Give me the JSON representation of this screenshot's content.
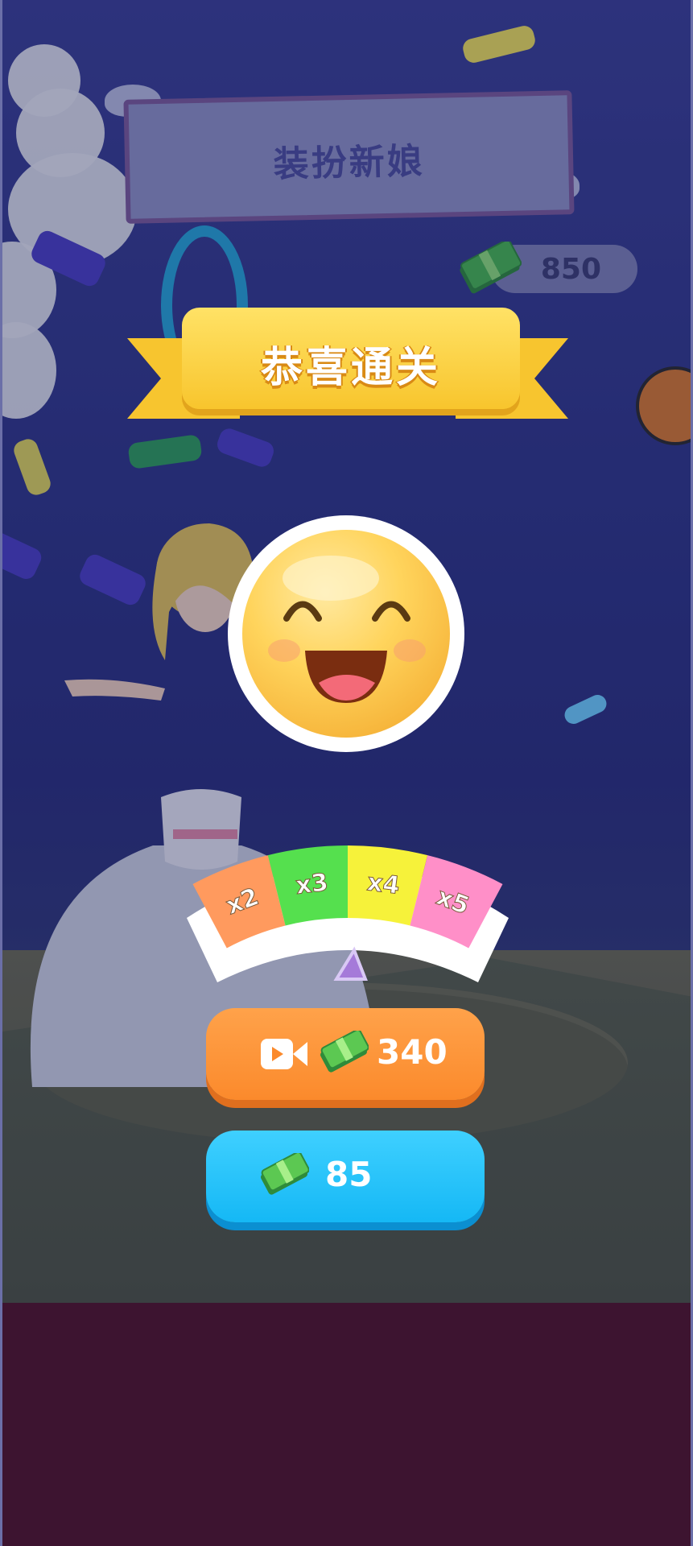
{
  "game": {
    "level_title": "装扮新娘",
    "banner": "恭喜通关",
    "money_total": "850"
  },
  "multiplier": {
    "segments": [
      {
        "label": "x2",
        "color": "#ff9a5e"
      },
      {
        "label": "x3",
        "color": "#55e04e"
      },
      {
        "label": "x4",
        "color": "#f6f23a"
      },
      {
        "label": "x5",
        "color": "#ff8fc8"
      }
    ],
    "pointer_color": "#a57ad9"
  },
  "buttons": {
    "video_reward": {
      "amount": "340",
      "icon": "video-camera-icon"
    },
    "claim": {
      "amount": "85",
      "icon": "cash-icon"
    }
  },
  "colors": {
    "orange_button": "#fb8a2c",
    "blue_button": "#15b8f5",
    "ribbon": "#f8c52d",
    "bottom_band": "#3d1430"
  }
}
